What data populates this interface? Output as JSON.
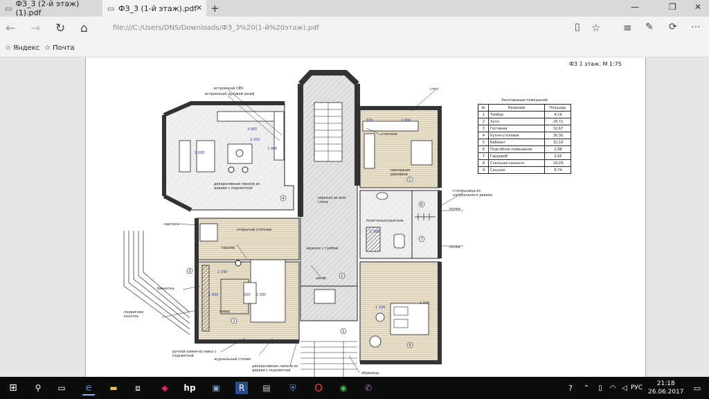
{
  "tabs": [
    {
      "label": "ФЗ_3 (2-й этаж)(1).pdf"
    },
    {
      "label": "ФЗ_3 (1-й этаж).pdf"
    }
  ],
  "address": {
    "url": "file:///C:/Users/DNS/Downloads/ФЗ_3%20(1-й%20этаж).pdf"
  },
  "favorites": [
    {
      "label": "Яндекс"
    },
    {
      "label": "Почта"
    }
  ],
  "doc": {
    "title": "ФЗ 1 этаж. М 1:75",
    "table": {
      "caption": "Экспликация помещений",
      "headers": [
        "№",
        "Название",
        "Площадь"
      ],
      "rows": [
        [
          "1",
          "Тамбур",
          "4,19"
        ],
        [
          "2",
          "Холл",
          "29,72"
        ],
        [
          "3",
          "Гостиная",
          "32,67"
        ],
        [
          "4",
          "Кухня-столовая",
          "30,30"
        ],
        [
          "5",
          "Кабинет",
          "15,19"
        ],
        [
          "6",
          "Подсобное помещение",
          "2,88"
        ],
        [
          "7",
          "Гардероб",
          "2,65"
        ],
        [
          "8",
          "Спальная комната",
          "18,29"
        ],
        [
          "9",
          "Санузел",
          "8,74"
        ]
      ]
    },
    "labels": {
      "l1": "встроенная СВЧ",
      "l2": "встроенный духовой шкаф",
      "l3": "стол",
      "l4": "стеллаж",
      "l5": "декоративные панели из дерева с подсветкой",
      "l6": "накладная раковина",
      "l7": "столешница из натурального дерева",
      "l8": "зеркало во всю стену",
      "l9": "полки",
      "l10": "картина",
      "l11": "открытый стеллаж",
      "l12": "полотенцесушитель",
      "l13": "торшер",
      "l14": "зеркало с тумбой",
      "l15": "полки",
      "l16": "шкаф",
      "l17": "банкетка",
      "l18": "подвесная консоль",
      "l19": "ковер",
      "l20": "ручной камин-вставка с подсветкой",
      "l21": "журнальный столик",
      "l22": "декоративные панели из дерева с подсветкой",
      "l23": "обувница"
    },
    "dims": {
      "d1": "3 065",
      "d2": "2 200",
      "d3": "1 600",
      "d4": "1 000",
      "d5": "930",
      "d6": "2 900",
      "d7": "1 300",
      "d8": "2 290",
      "d9": "1 900",
      "d10": "200",
      "d11": "1 000",
      "d12": "1 100",
      "d13": "1 000"
    }
  },
  "taskbar": {
    "lang": "РУС",
    "time": "21:18",
    "date": "26.06.2017"
  }
}
